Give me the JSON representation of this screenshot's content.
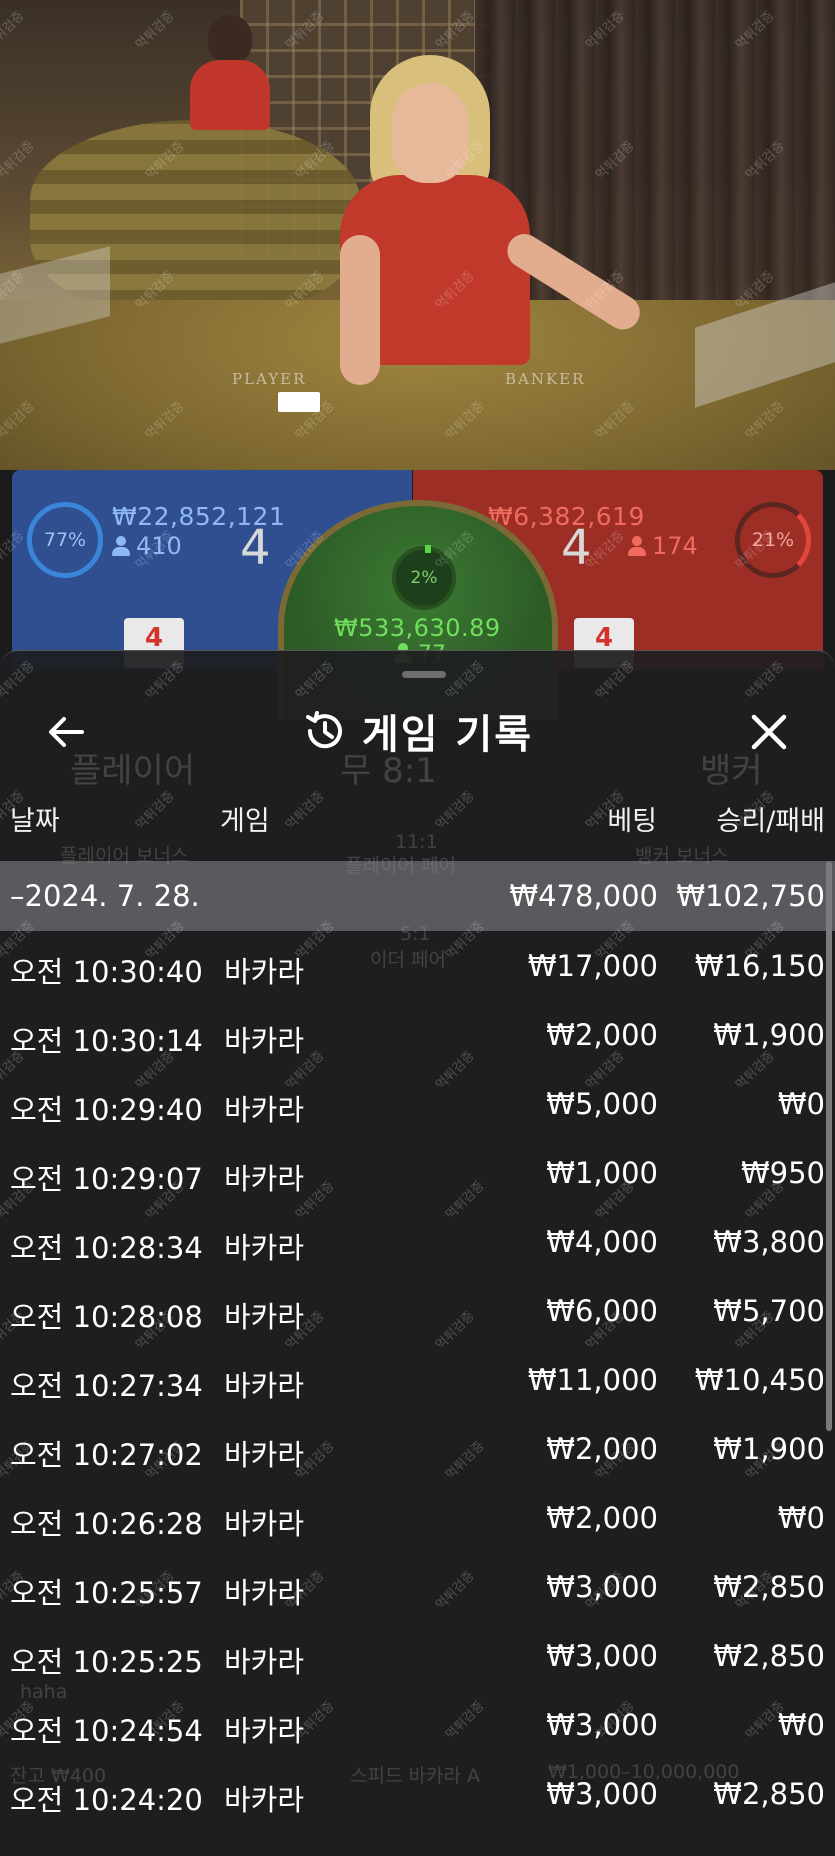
{
  "colors": {
    "player_blue": "#2f4f91",
    "banker_red": "#9c2e26",
    "tie_green": "#3c7a33",
    "sheet_bg": "#1e1e20"
  },
  "video": {
    "felt_player": "PLAYER",
    "felt_banker": "BANKER"
  },
  "bet_panels": {
    "player": {
      "percent": "77%",
      "amount": "₩22,852,121",
      "count": "410",
      "score": "4",
      "card": "4"
    },
    "tie": {
      "percent": "2%",
      "amount": "₩533,630.89",
      "count": "77"
    },
    "banker": {
      "percent": "21%",
      "amount": "₩6,382,619",
      "count": "174",
      "score": "4",
      "card": "4"
    }
  },
  "history": {
    "title": "게임 기록",
    "icons": {
      "back": "arrow-left-icon",
      "history": "history-clock-icon",
      "close": "close-x-icon"
    },
    "columns": {
      "date": "날짜",
      "game": "게임",
      "bet": "베팅",
      "result": "승리/패배"
    },
    "summary": {
      "date": "–2024. 7. 28.",
      "bet": "₩478,000",
      "result": "₩102,750"
    },
    "rows": [
      {
        "time": "오전 10:30:40",
        "game": "바카라",
        "bet": "₩17,000",
        "result": "₩16,150"
      },
      {
        "time": "오전 10:30:14",
        "game": "바카라",
        "bet": "₩2,000",
        "result": "₩1,900"
      },
      {
        "time": "오전 10:29:40",
        "game": "바카라",
        "bet": "₩5,000",
        "result": "₩0"
      },
      {
        "time": "오전 10:29:07",
        "game": "바카라",
        "bet": "₩1,000",
        "result": "₩950"
      },
      {
        "time": "오전 10:28:34",
        "game": "바카라",
        "bet": "₩4,000",
        "result": "₩3,800"
      },
      {
        "time": "오전 10:28:08",
        "game": "바카라",
        "bet": "₩6,000",
        "result": "₩5,700"
      },
      {
        "time": "오전 10:27:34",
        "game": "바카라",
        "bet": "₩11,000",
        "result": "₩10,450"
      },
      {
        "time": "오전 10:27:02",
        "game": "바카라",
        "bet": "₩2,000",
        "result": "₩1,900"
      },
      {
        "time": "오전 10:26:28",
        "game": "바카라",
        "bet": "₩2,000",
        "result": "₩0"
      },
      {
        "time": "오전 10:25:57",
        "game": "바카라",
        "bet": "₩3,000",
        "result": "₩2,850"
      },
      {
        "time": "오전 10:25:25",
        "game": "바카라",
        "bet": "₩3,000",
        "result": "₩2,850"
      },
      {
        "time": "오전 10:24:54",
        "game": "바카라",
        "bet": "₩3,000",
        "result": "₩0"
      },
      {
        "time": "오전 10:24:20",
        "game": "바카라",
        "bet": "₩3,000",
        "result": "₩2,850"
      }
    ]
  },
  "background_ui": {
    "player_label": "플레이어",
    "tie_label": "무 8:1",
    "banker_label": "뱅커",
    "player_bonus": "플레이어 보너스",
    "perfect_pair": "플레이어 페어",
    "banker_bonus": "뱅커 보너스",
    "either_pair": "이더 페어",
    "ratio_11_1": "11:1",
    "ratio_5_1": "5:1",
    "table_name": "스피드 바카라 A",
    "limits": "₩1,000–10,000,000",
    "balance": "잔고 ₩400",
    "chat_text": "haha"
  },
  "watermark": "먹튀검증"
}
